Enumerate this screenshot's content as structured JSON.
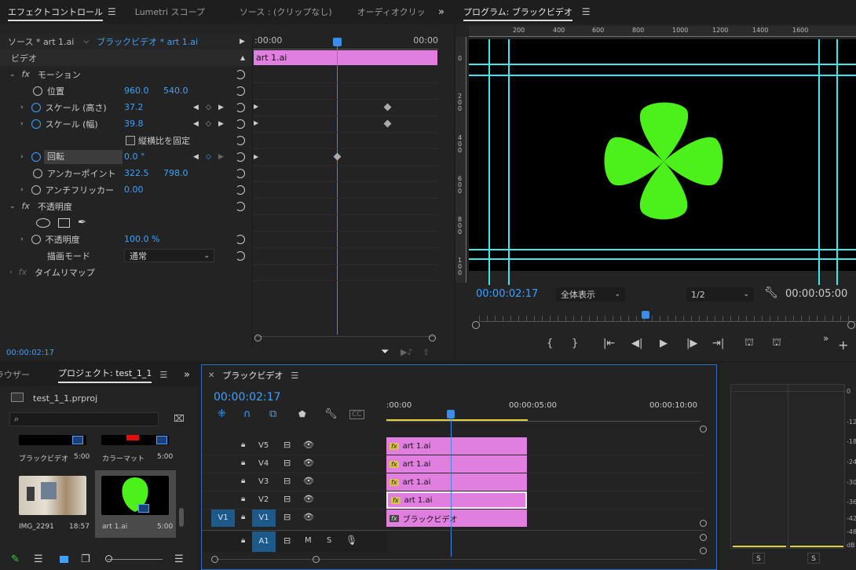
{
  "effects_panel": {
    "tabs": [
      "エフェクトコントロール",
      "Lumetri スコープ",
      "ソース : (クリップなし)",
      "オーディオクリッ"
    ],
    "menu_icon": "hamburger-icon",
    "source_label": "ソース * art 1.ai",
    "sequence_label": "ブラックビデオ * art 1.ai",
    "ruler_start": ":00:00",
    "ruler_end": "00:00",
    "clip_label": "art 1.ai",
    "section_video": "ビデオ",
    "motion": "モーション",
    "position_label": "位置",
    "position_x": "960.0",
    "position_y": "540.0",
    "scale_h_label": "スケール (高さ)",
    "scale_h_value": "37.2",
    "scale_w_label": "スケール (幅)",
    "scale_w_value": "39.8",
    "uniform_scale_label": "縦横比を固定",
    "rotation_label": "回転",
    "rotation_value": "0.0 °",
    "anchor_label": "アンカーポイント",
    "anchor_x": "322.5",
    "anchor_y": "798.0",
    "antiflicker_label": "アンチフリッカー",
    "antiflicker_value": "0.00",
    "opacity_section": "不透明度",
    "opacity_label": "不透明度",
    "opacity_value": "100.0 %",
    "blend_label": "描画モード",
    "blend_value": "通常",
    "time_remap": "タイムリマップ",
    "timecode": "00:00:02:17"
  },
  "program_monitor": {
    "title": "プログラム: ブラックビデオ",
    "ruler_ticks": [
      "200",
      "400",
      "600",
      "800",
      "1000",
      "1200",
      "1400",
      "1600"
    ],
    "vruler_ticks": [
      "0",
      "2\n0\n0",
      "4\n0\n0",
      "6\n0\n0",
      "8\n0\n0",
      "1\n0\n0"
    ],
    "timecode": "00:00:02:17",
    "fit_value": "全体表示",
    "resolution_value": "1/2",
    "duration": "00:00:05:00",
    "accent": "#3ea1ff",
    "shape_color": "#4cf01a"
  },
  "project_panel": {
    "tab_left": "ラウザー",
    "tab_active": "プロジェクト: test_1_1",
    "project_file": "test_1_1.prproj",
    "search_placeholder": "",
    "items": [
      {
        "name": "ブラックビデオ",
        "duration": "5:00"
      },
      {
        "name": "カラーマット",
        "duration": "5:00"
      },
      {
        "name": "IMG_2291",
        "duration": "18:57"
      },
      {
        "name": "art 1.ai",
        "duration": "5:00"
      }
    ]
  },
  "timeline": {
    "title": "ブラックビデオ",
    "timecode": "00:00:02:17",
    "ruler": [
      ":00:00",
      "00:00:05:00",
      "00:00:10:00"
    ],
    "tracks": [
      {
        "name": "V5",
        "clip": "art 1.ai"
      },
      {
        "name": "V4",
        "clip": "art 1.ai"
      },
      {
        "name": "V3",
        "clip": "art 1.ai"
      },
      {
        "name": "V2",
        "clip": "art 1.ai"
      },
      {
        "name": "V1",
        "clip": "ブラックビデオ"
      }
    ],
    "source_patch_v": "V1",
    "audio_track": "A1",
    "audio_m": "M",
    "audio_s": "S",
    "playhead_fraction": 0.475
  },
  "audio_meter": {
    "ticks": [
      "0",
      "-12",
      "-18",
      "-24",
      "-30",
      "-36",
      "-42",
      "-48",
      "dB"
    ],
    "solo_left": "S",
    "solo_right": "S"
  }
}
